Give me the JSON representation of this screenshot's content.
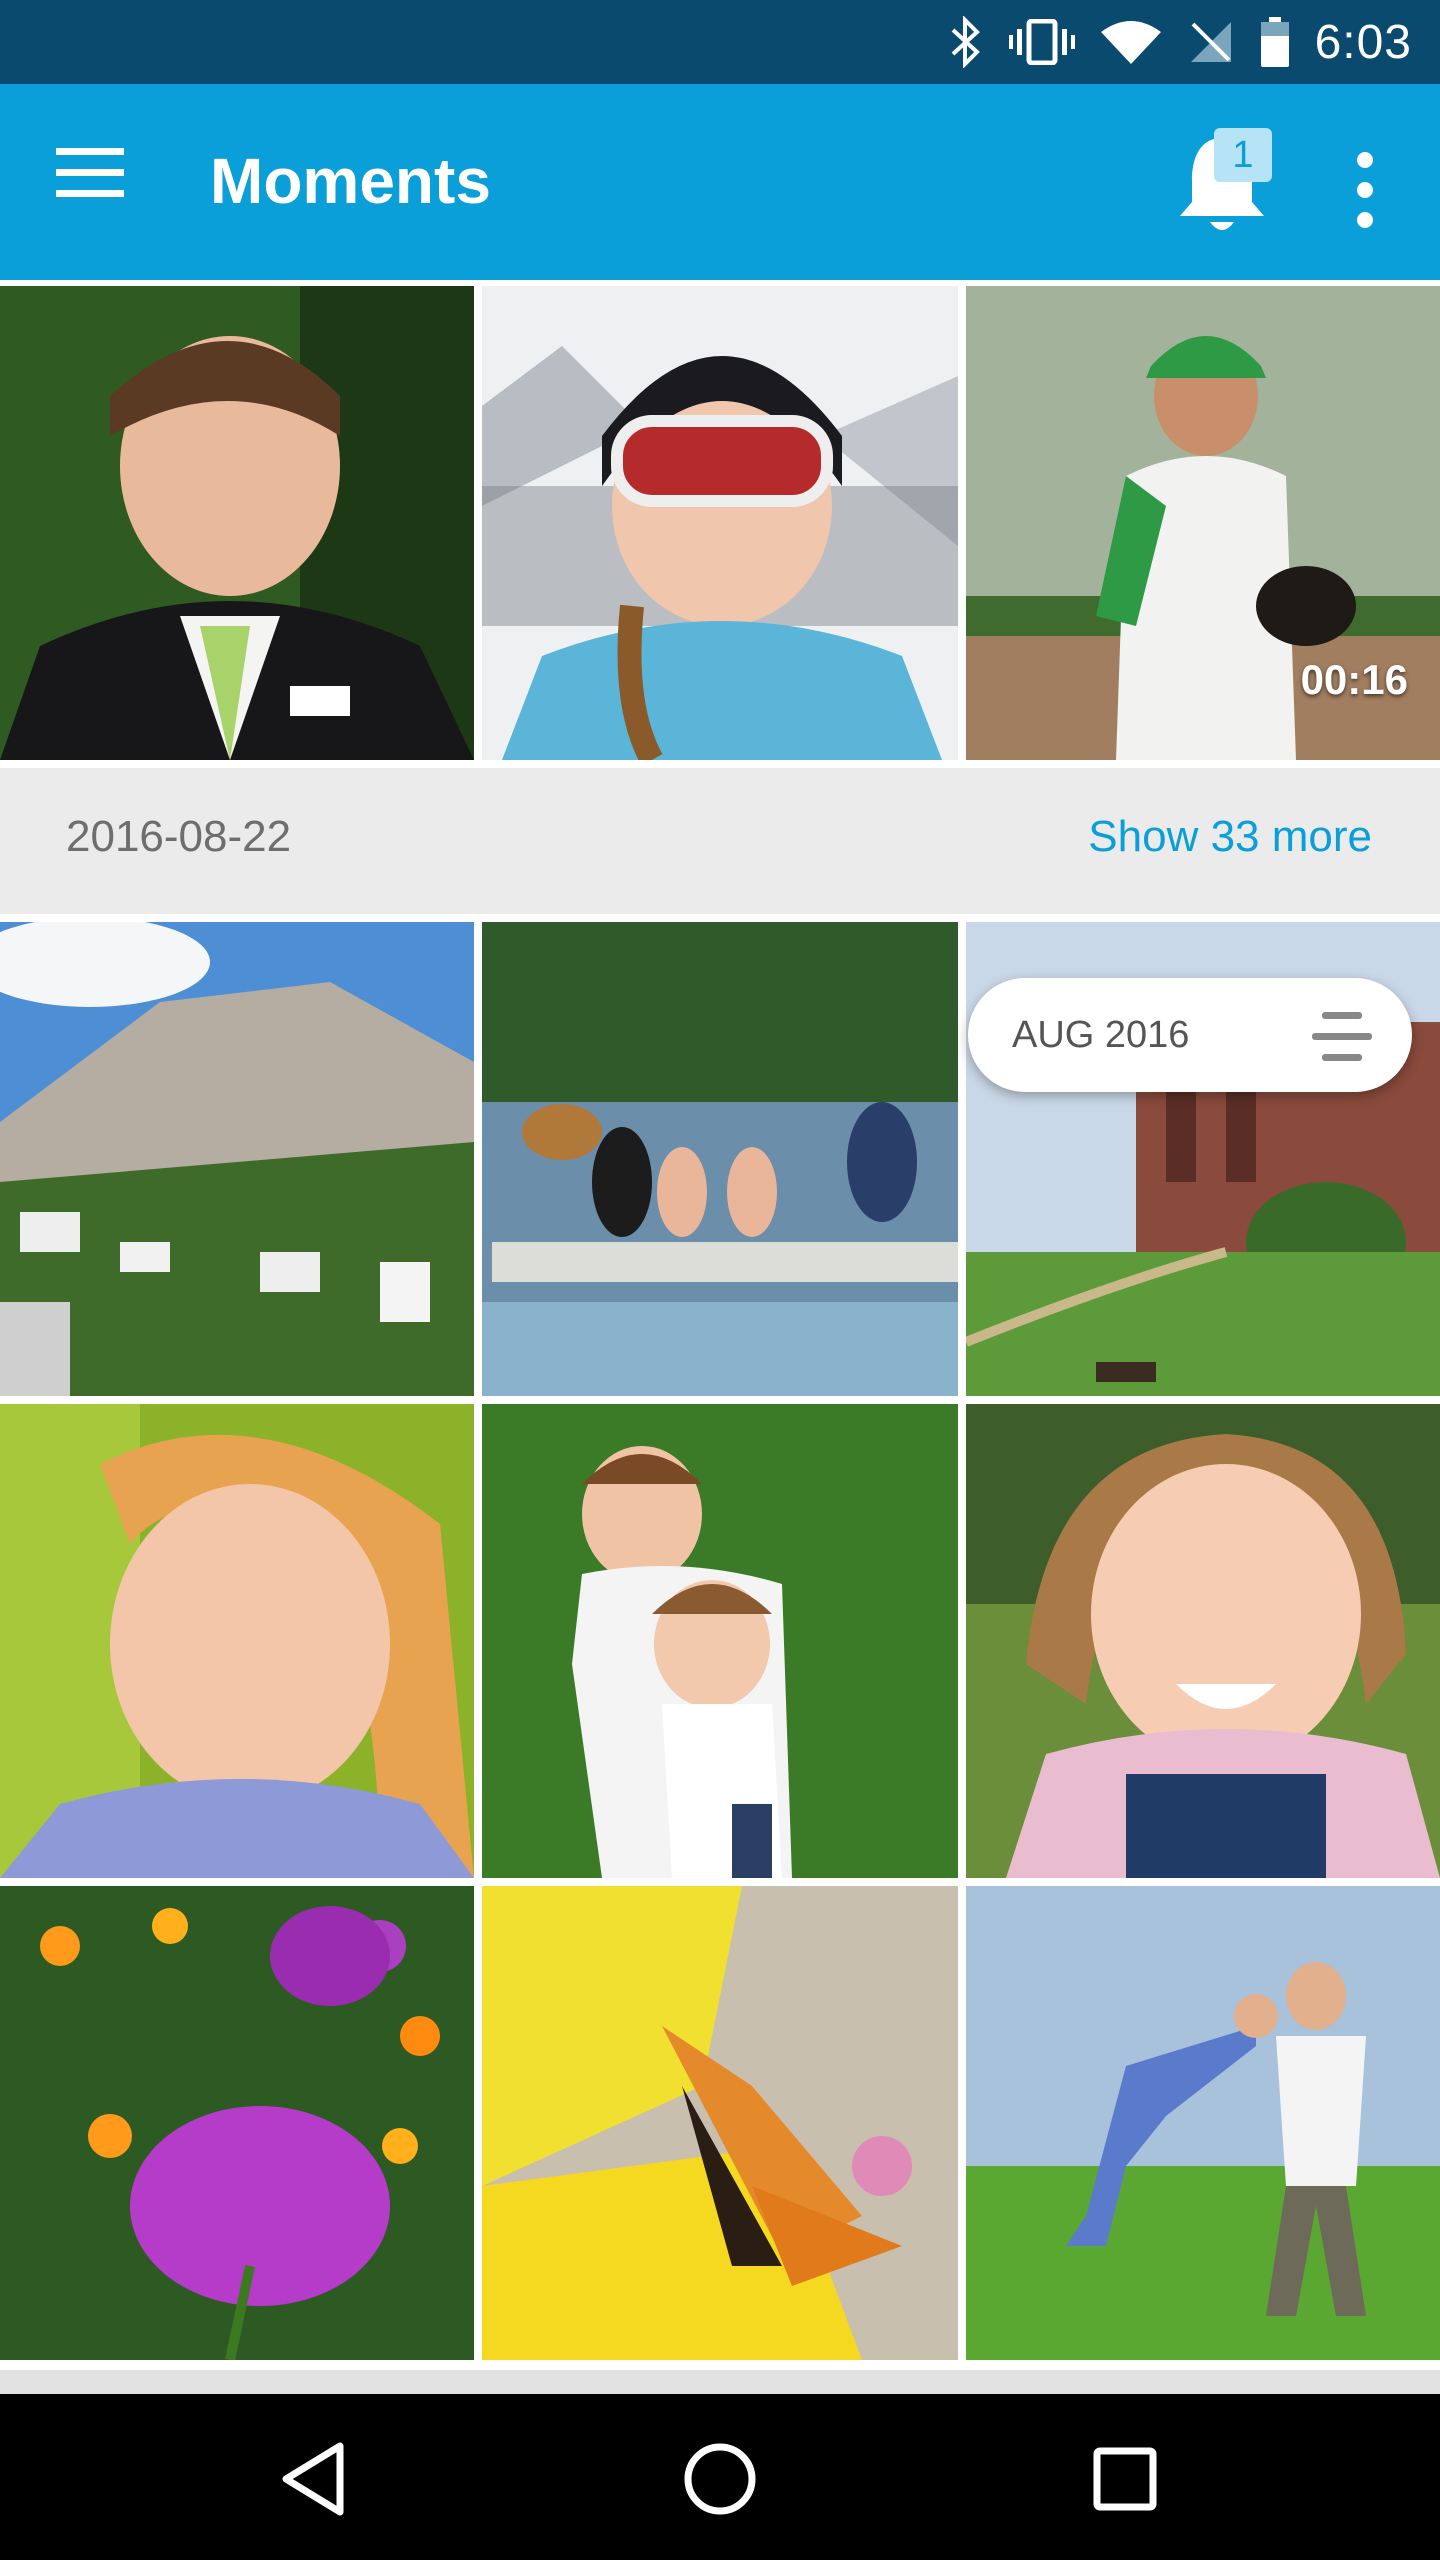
{
  "status_bar": {
    "time": "6:03",
    "icons": [
      "bluetooth-icon",
      "vibrate-icon",
      "wifi-icon",
      "no-sim-icon",
      "battery-icon"
    ]
  },
  "app_bar": {
    "title": "Moments",
    "notification_count": "1",
    "icons": [
      "menu-icon",
      "bell-icon",
      "more-vert-icon"
    ],
    "background_color": "#0a9fd8"
  },
  "top_row": [
    {
      "subject": "boy in suit",
      "duration": ""
    },
    {
      "subject": "girl with ski goggles",
      "duration": ""
    },
    {
      "subject": "boy baseball",
      "duration": "00:16"
    }
  ],
  "date_group": {
    "date": "2016-08-22",
    "show_more": "Show 33 more"
  },
  "date_chip": {
    "label": "AUG 2016"
  },
  "grid": [
    {
      "subject": "coastal mountain town"
    },
    {
      "subject": "family with dog on dock"
    },
    {
      "subject": "ruins and park"
    },
    {
      "subject": "smiling girl portrait"
    },
    {
      "subject": "two boys playing"
    },
    {
      "subject": "girl with pigtails"
    },
    {
      "subject": "purple and orange flowers"
    },
    {
      "subject": "butterfly on yellow flowers"
    },
    {
      "subject": "father swinging child"
    }
  ],
  "nav_bar": {
    "icons": [
      "back-icon",
      "home-icon",
      "recents-icon"
    ]
  }
}
